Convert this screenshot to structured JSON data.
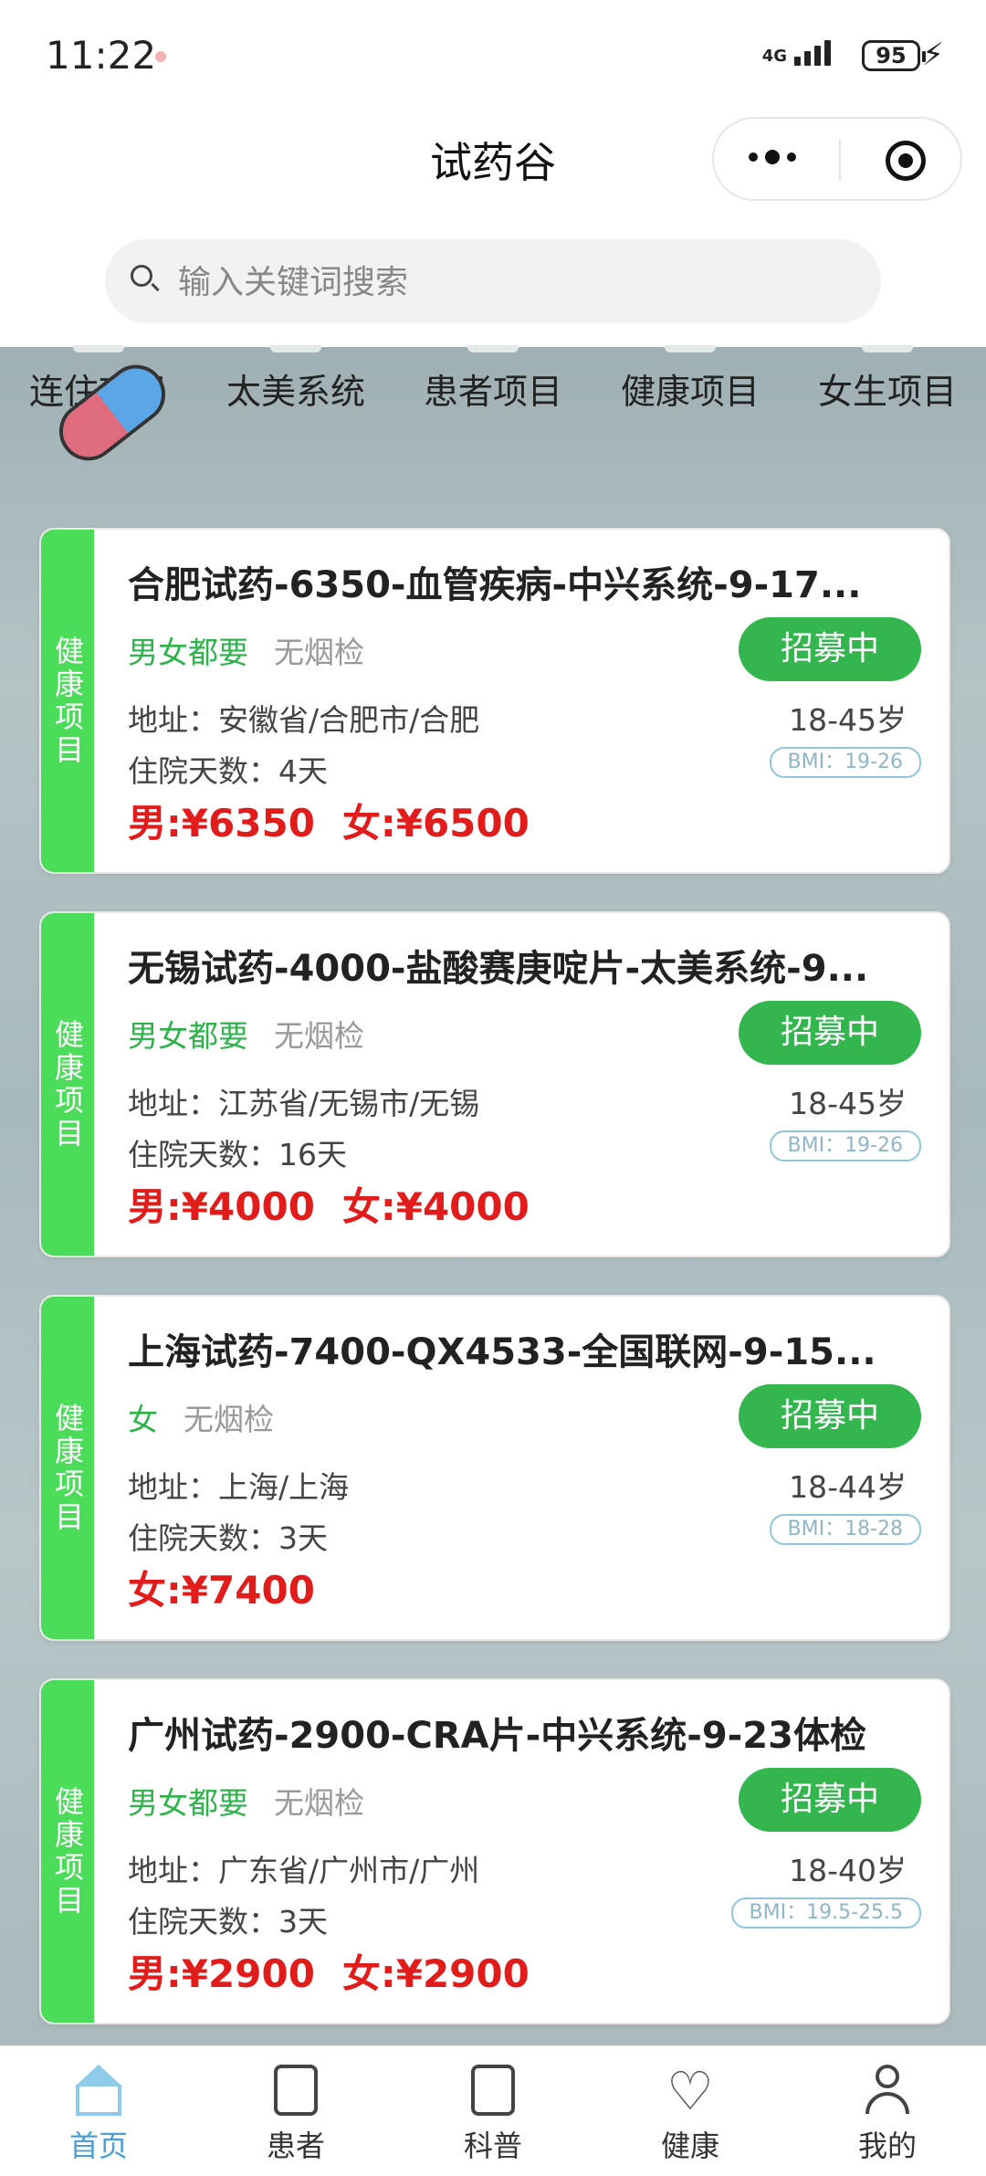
{
  "status_bar": {
    "time": "11:22",
    "network": "4G",
    "battery": "95"
  },
  "header": {
    "title": "试药谷"
  },
  "search": {
    "placeholder": "输入关键词搜索"
  },
  "categories": [
    "连住项目",
    "太美系统",
    "患者项目",
    "健康项目",
    "女生项目"
  ],
  "cards": [
    {
      "tag": "健康项目",
      "title": "合肥试药-6350-血管疾病-中兴系统-9-17...",
      "gender": "男女都要",
      "smoke": "无烟检",
      "status": "招募中",
      "address": "地址：安徽省/合肥市/合肥",
      "age": "18-45岁",
      "days": "住院天数：4天",
      "bmi": "BMI：19-26",
      "price_male": "男:¥6350",
      "price_female": "女:¥6500"
    },
    {
      "tag": "健康项目",
      "title": "无锡试药-4000-盐酸赛庚啶片-太美系统-9...",
      "gender": "男女都要",
      "smoke": "无烟检",
      "status": "招募中",
      "address": "地址：江苏省/无锡市/无锡",
      "age": "18-45岁",
      "days": "住院天数：16天",
      "bmi": "BMI：19-26",
      "price_male": "男:¥4000",
      "price_female": "女:¥4000"
    },
    {
      "tag": "健康项目",
      "title": "上海试药-7400-QX4533-全国联网-9-15...",
      "gender": "女",
      "smoke": "无烟检",
      "status": "招募中",
      "address": "地址：上海/上海",
      "age": "18-44岁",
      "days": "住院天数：3天",
      "bmi": "BMI：18-28",
      "price_male": "",
      "price_female": "女:¥7400"
    },
    {
      "tag": "健康项目",
      "title": "广州试药-2900-CRA片-中兴系统-9-23体检",
      "gender": "男女都要",
      "smoke": "无烟检",
      "status": "招募中",
      "address": "地址：广东省/广州市/广州",
      "age": "18-40岁",
      "days": "住院天数：3天",
      "bmi": "BMI：19.5-25.5",
      "price_male": "男:¥2900",
      "price_female": "女:¥2900"
    }
  ],
  "tabbar": {
    "items": [
      "首页",
      "患者",
      "科普",
      "健康",
      "我的"
    ],
    "active": "首页"
  }
}
